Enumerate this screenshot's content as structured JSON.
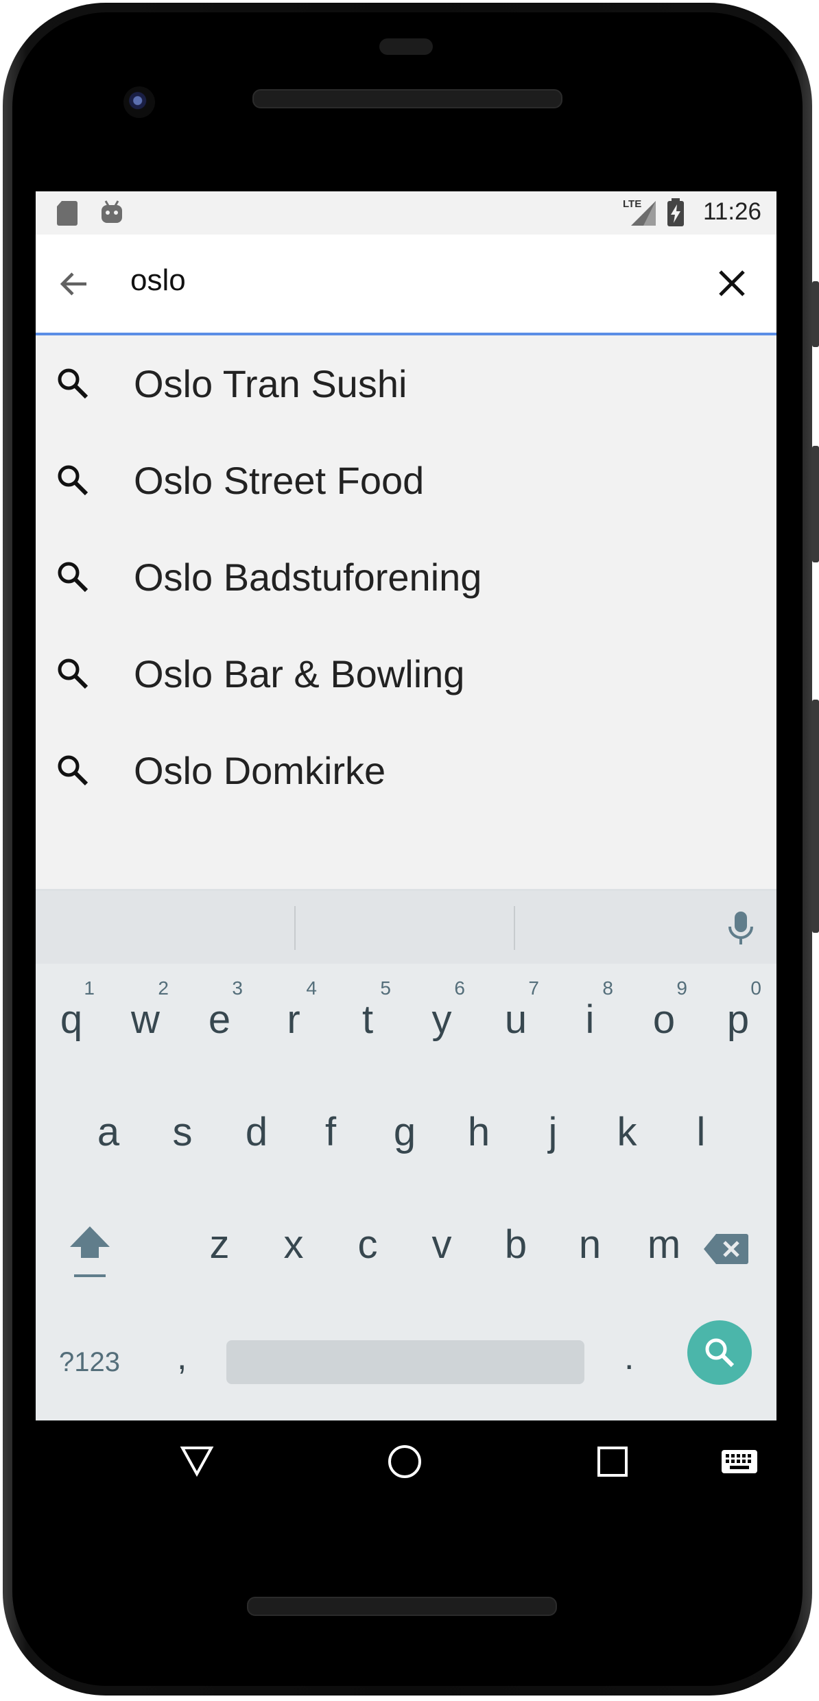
{
  "status_bar": {
    "time": "11:26",
    "network": "LTE"
  },
  "search": {
    "query": "oslo"
  },
  "suggestions": [
    {
      "label": "Oslo Tran Sushi"
    },
    {
      "label": "Oslo Street Food"
    },
    {
      "label": "Oslo Badstuforening"
    },
    {
      "label": "Oslo Bar & Bowling"
    },
    {
      "label": "Oslo Domkirke"
    }
  ],
  "keyboard": {
    "row1": [
      {
        "ch": "q",
        "num": "1"
      },
      {
        "ch": "w",
        "num": "2"
      },
      {
        "ch": "e",
        "num": "3"
      },
      {
        "ch": "r",
        "num": "4"
      },
      {
        "ch": "t",
        "num": "5"
      },
      {
        "ch": "y",
        "num": "6"
      },
      {
        "ch": "u",
        "num": "7"
      },
      {
        "ch": "i",
        "num": "8"
      },
      {
        "ch": "o",
        "num": "9"
      },
      {
        "ch": "p",
        "num": "0"
      }
    ],
    "row2": [
      "a",
      "s",
      "d",
      "f",
      "g",
      "h",
      "j",
      "k",
      "l"
    ],
    "row3": [
      "z",
      "x",
      "c",
      "v",
      "b",
      "n",
      "m"
    ],
    "symbols_label": "?123",
    "comma_label": ",",
    "period_label": "."
  },
  "colors": {
    "accent_underline": "#5b8ee6",
    "search_fab": "#4bb6aa",
    "screen_bg": "#f2f2f2"
  },
  "icons": [
    "back-arrow-icon",
    "close-icon",
    "search-icon",
    "mic-icon",
    "shift-icon",
    "backspace-icon",
    "nav-back-icon",
    "nav-home-icon",
    "nav-recents-icon",
    "keyboard-icon",
    "sd-card-icon",
    "android-icon",
    "lte-signal-icon",
    "battery-charging-icon"
  ]
}
